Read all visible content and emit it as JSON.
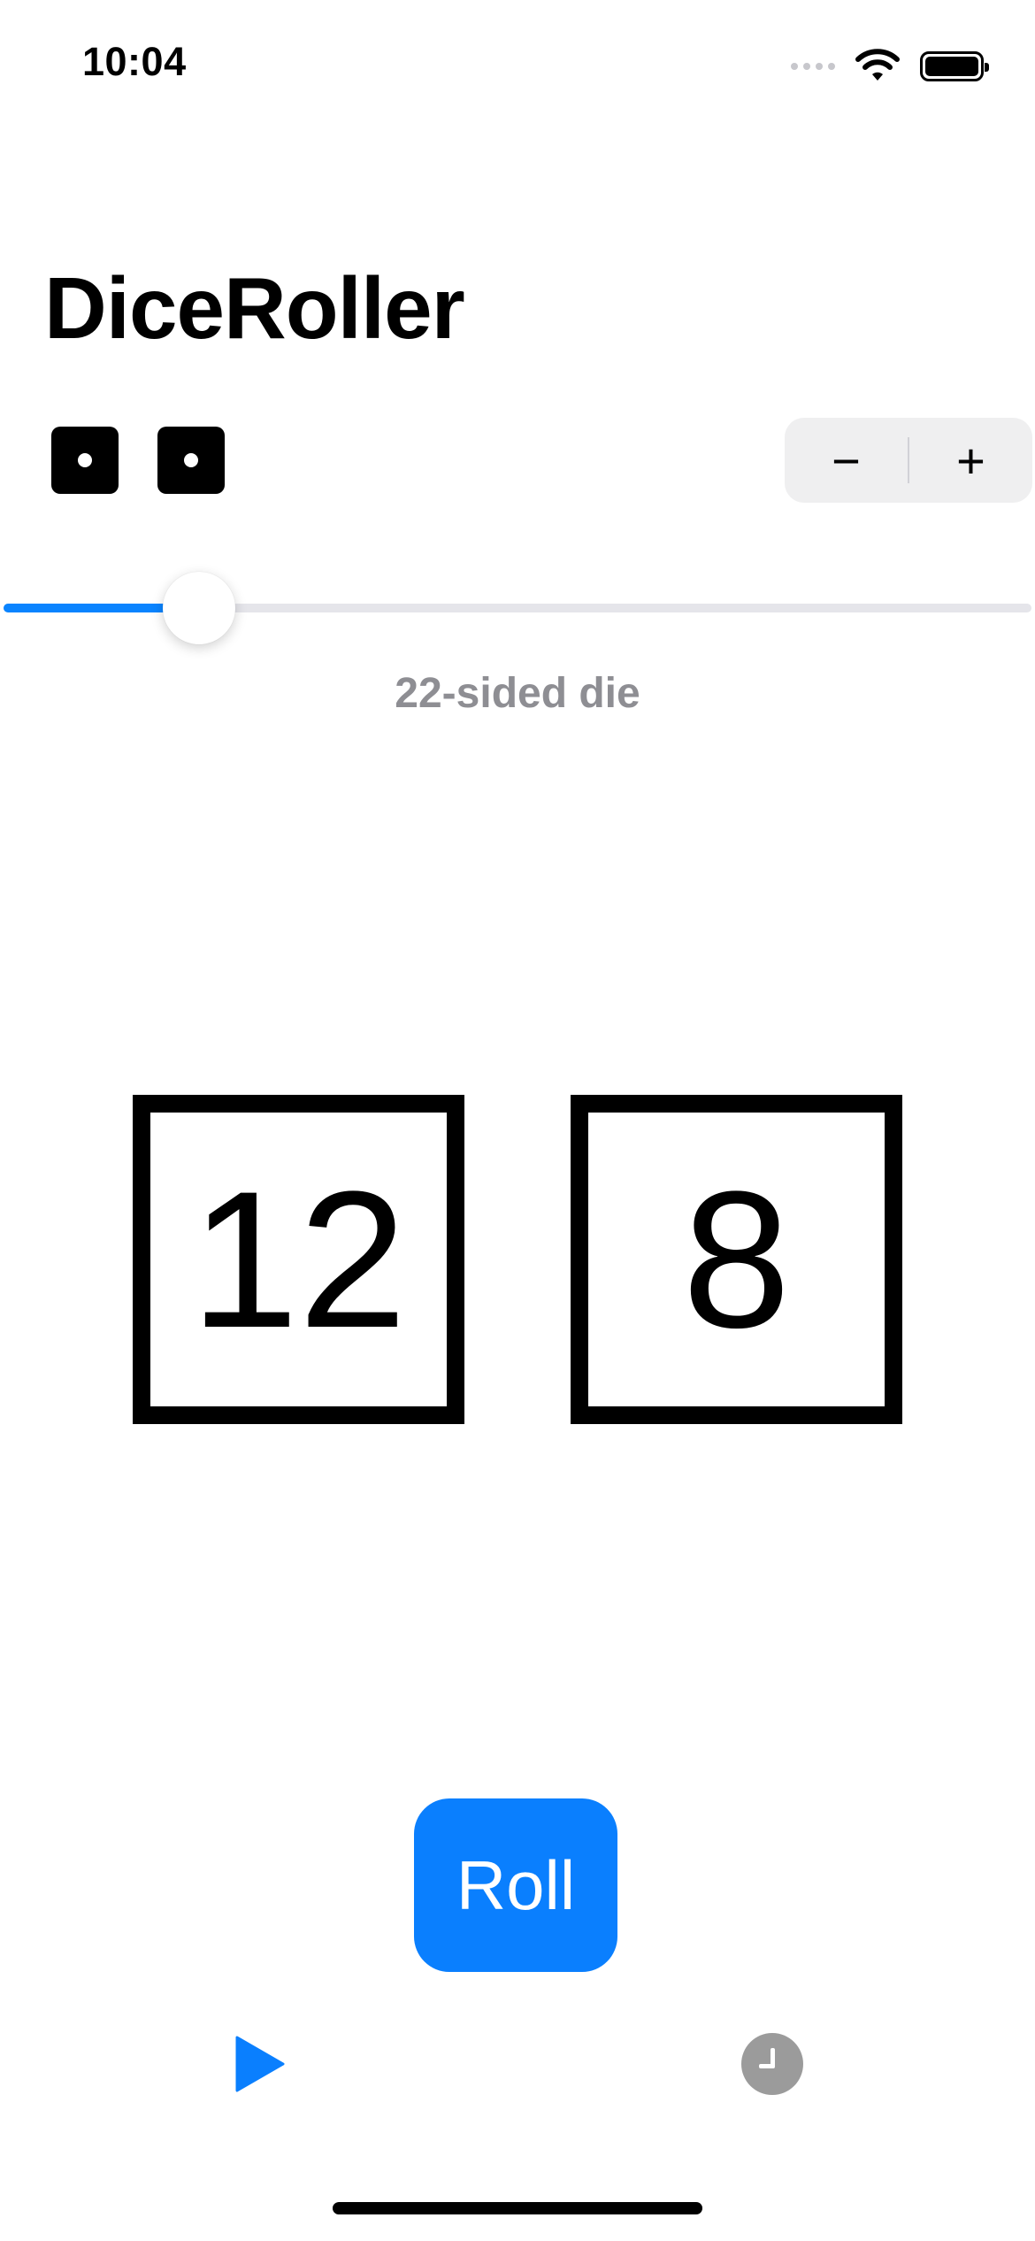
{
  "status_bar": {
    "time": "10:04",
    "wifi_icon": "wifi-icon",
    "battery_icon": "battery-full-icon"
  },
  "title": "DiceRoller",
  "dice_count_icons": [
    {
      "icon": "die-face-one-icon"
    },
    {
      "icon": "die-face-one-icon"
    }
  ],
  "stepper": {
    "decrement_label": "−",
    "increment_label": "+"
  },
  "slider": {
    "value_fraction": 0.19,
    "caption": "22-sided die",
    "accent_color": "#0a84ff"
  },
  "results": [
    "12",
    "8"
  ],
  "roll_button": {
    "label": "Roll",
    "color": "#0a7ffe"
  },
  "tab_bar": {
    "items": [
      {
        "icon": "play-icon",
        "active": true,
        "color": "#0a7ffe"
      },
      {
        "icon": "history-clock-icon",
        "active": false,
        "color": "#9b9b9b"
      }
    ]
  }
}
